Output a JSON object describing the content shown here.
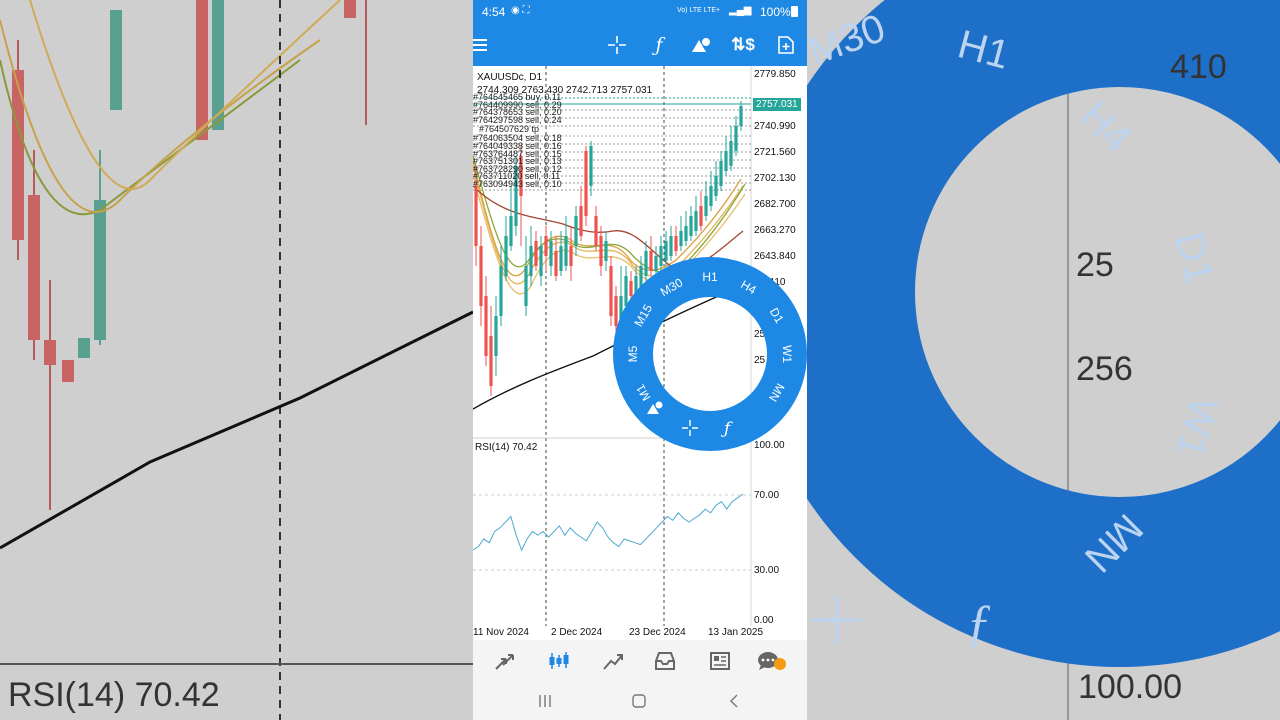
{
  "status": {
    "time": "4:54",
    "battery": "100%",
    "network": "Vo) LTE LTE+"
  },
  "chart": {
    "symbol": "XAUUSDc, D1",
    "ohlc": "2744.309 2763.430 2742.713 2757.031",
    "current_price": "2757.031",
    "price_axis": [
      "2779.850",
      "2740.990",
      "2721.560",
      "2702.130",
      "2682.700",
      "2663.270",
      "2643.840"
    ],
    "price_axis_partial": [
      ".410",
      "25",
      "25",
      "50"
    ],
    "orders": [
      "#764545465 buy, 0.11",
      "#764409990 sell, 0.29",
      "#764378653 sell, 0.20",
      "#764297598 sell, 0.24",
      "#764507629 tp",
      "#764063504 sell, 0.18",
      "#764049338 sell, 0.16",
      "#763764487 sell, 0.15",
      "#763751301 sell, 0.13",
      "#763728290 sell, 0.12",
      "#763711020 sell, 0.11",
      "#763094943 sell, 0.10"
    ],
    "rsi_label": "RSI(14) 70.42",
    "rsi_axis": [
      "100.00",
      "70.00",
      "30.00",
      "0.00"
    ],
    "dates": [
      "11 Nov 2024",
      "2 Dec 2024",
      "23 Dec 2024",
      "13 Jan 2025"
    ]
  },
  "timeframes": [
    "M1",
    "M5",
    "M15",
    "M30",
    "H1",
    "H4",
    "D1",
    "W1",
    "MN"
  ],
  "background": {
    "rsi_label": "RSI(14) 70.42",
    "price_labels": [
      "410",
      "25",
      "256",
      "100.00"
    ],
    "ring_labels": [
      "M30",
      "H1",
      "H4",
      "D1",
      "W1",
      "MN"
    ]
  },
  "colors": {
    "accent": "#1e88e5",
    "bull": "#26a69a",
    "bear": "#ef5350"
  }
}
